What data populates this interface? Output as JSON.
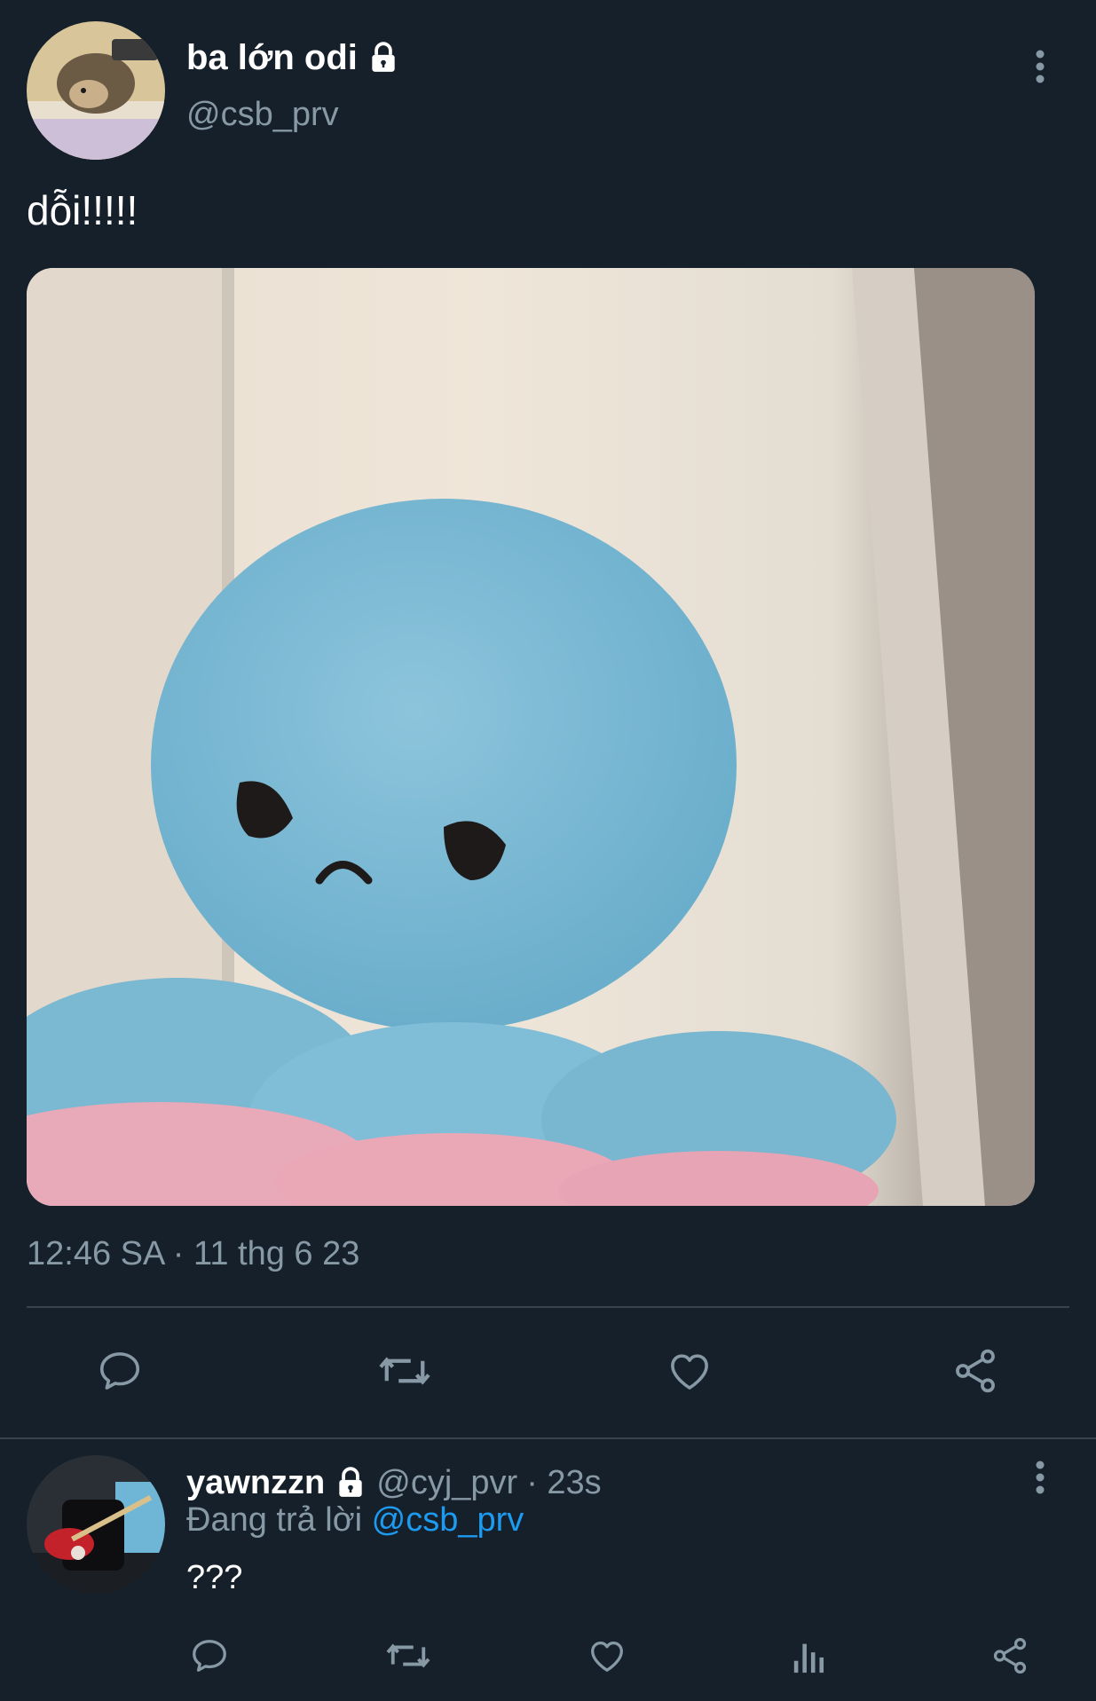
{
  "main_tweet": {
    "author_name": "ba lớn odi",
    "author_handle": "@csb_prv",
    "text": "dỗi!!!!!",
    "timestamp": "12:46 SA · 11 thg 6 23",
    "icons": {
      "lock": "lock-icon",
      "more": "more-vertical-icon",
      "reply": "reply-icon",
      "retweet": "retweet-icon",
      "like": "heart-icon",
      "share": "share-icon"
    }
  },
  "reply_tweet": {
    "author_name": "yawnzzn",
    "author_handle": "@cyj_pvr",
    "time_ago": "· 23s",
    "replying_prefix": "Đang trả lời",
    "replying_to": "@csb_prv",
    "text": "???",
    "icons": {
      "lock": "lock-icon",
      "more": "more-vertical-icon",
      "reply": "reply-icon",
      "retweet": "retweet-icon",
      "like": "heart-icon",
      "views": "analytics-icon",
      "share": "share-icon"
    }
  },
  "colors": {
    "background": "#15202b",
    "text": "#ffffff",
    "muted": "#8899a6",
    "link": "#1d9bf0",
    "divider": "#38444d"
  }
}
